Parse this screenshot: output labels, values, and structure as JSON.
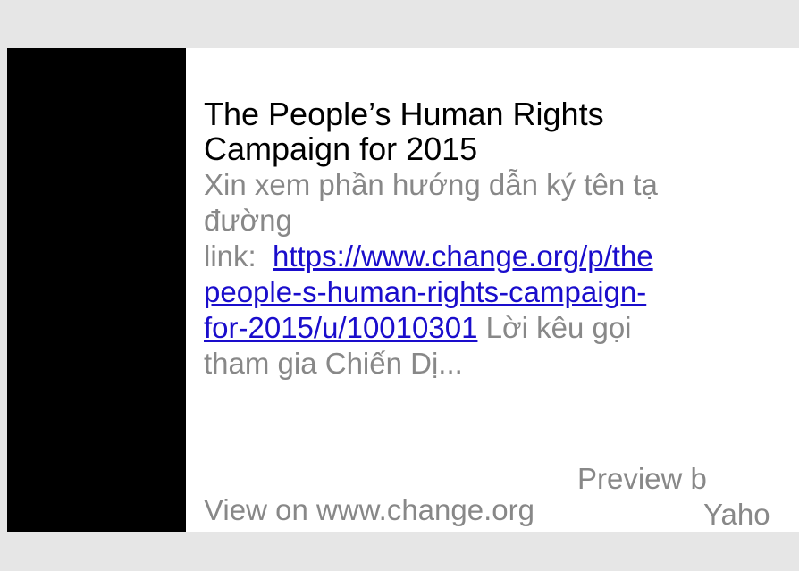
{
  "card": {
    "title": "The People’s Human Rights Campaign for 2015",
    "description": {
      "line1": "Xin xem phần hướng dẫn ký tên tạ",
      "line2": "đường",
      "link_prefix": "link:",
      "link_line1": "https://www.change.org/p/the",
      "link_line2": "people-s-human-rights-campaign-",
      "link_line3": "for-2015/u/10010301",
      "after_link": "Lời kêu gọi",
      "line_last": "tham gia Chiến Dị..."
    },
    "view_on": "View on www.change.org",
    "preview_by_line1": "Preview b",
    "preview_by_line2": "Yaho"
  }
}
